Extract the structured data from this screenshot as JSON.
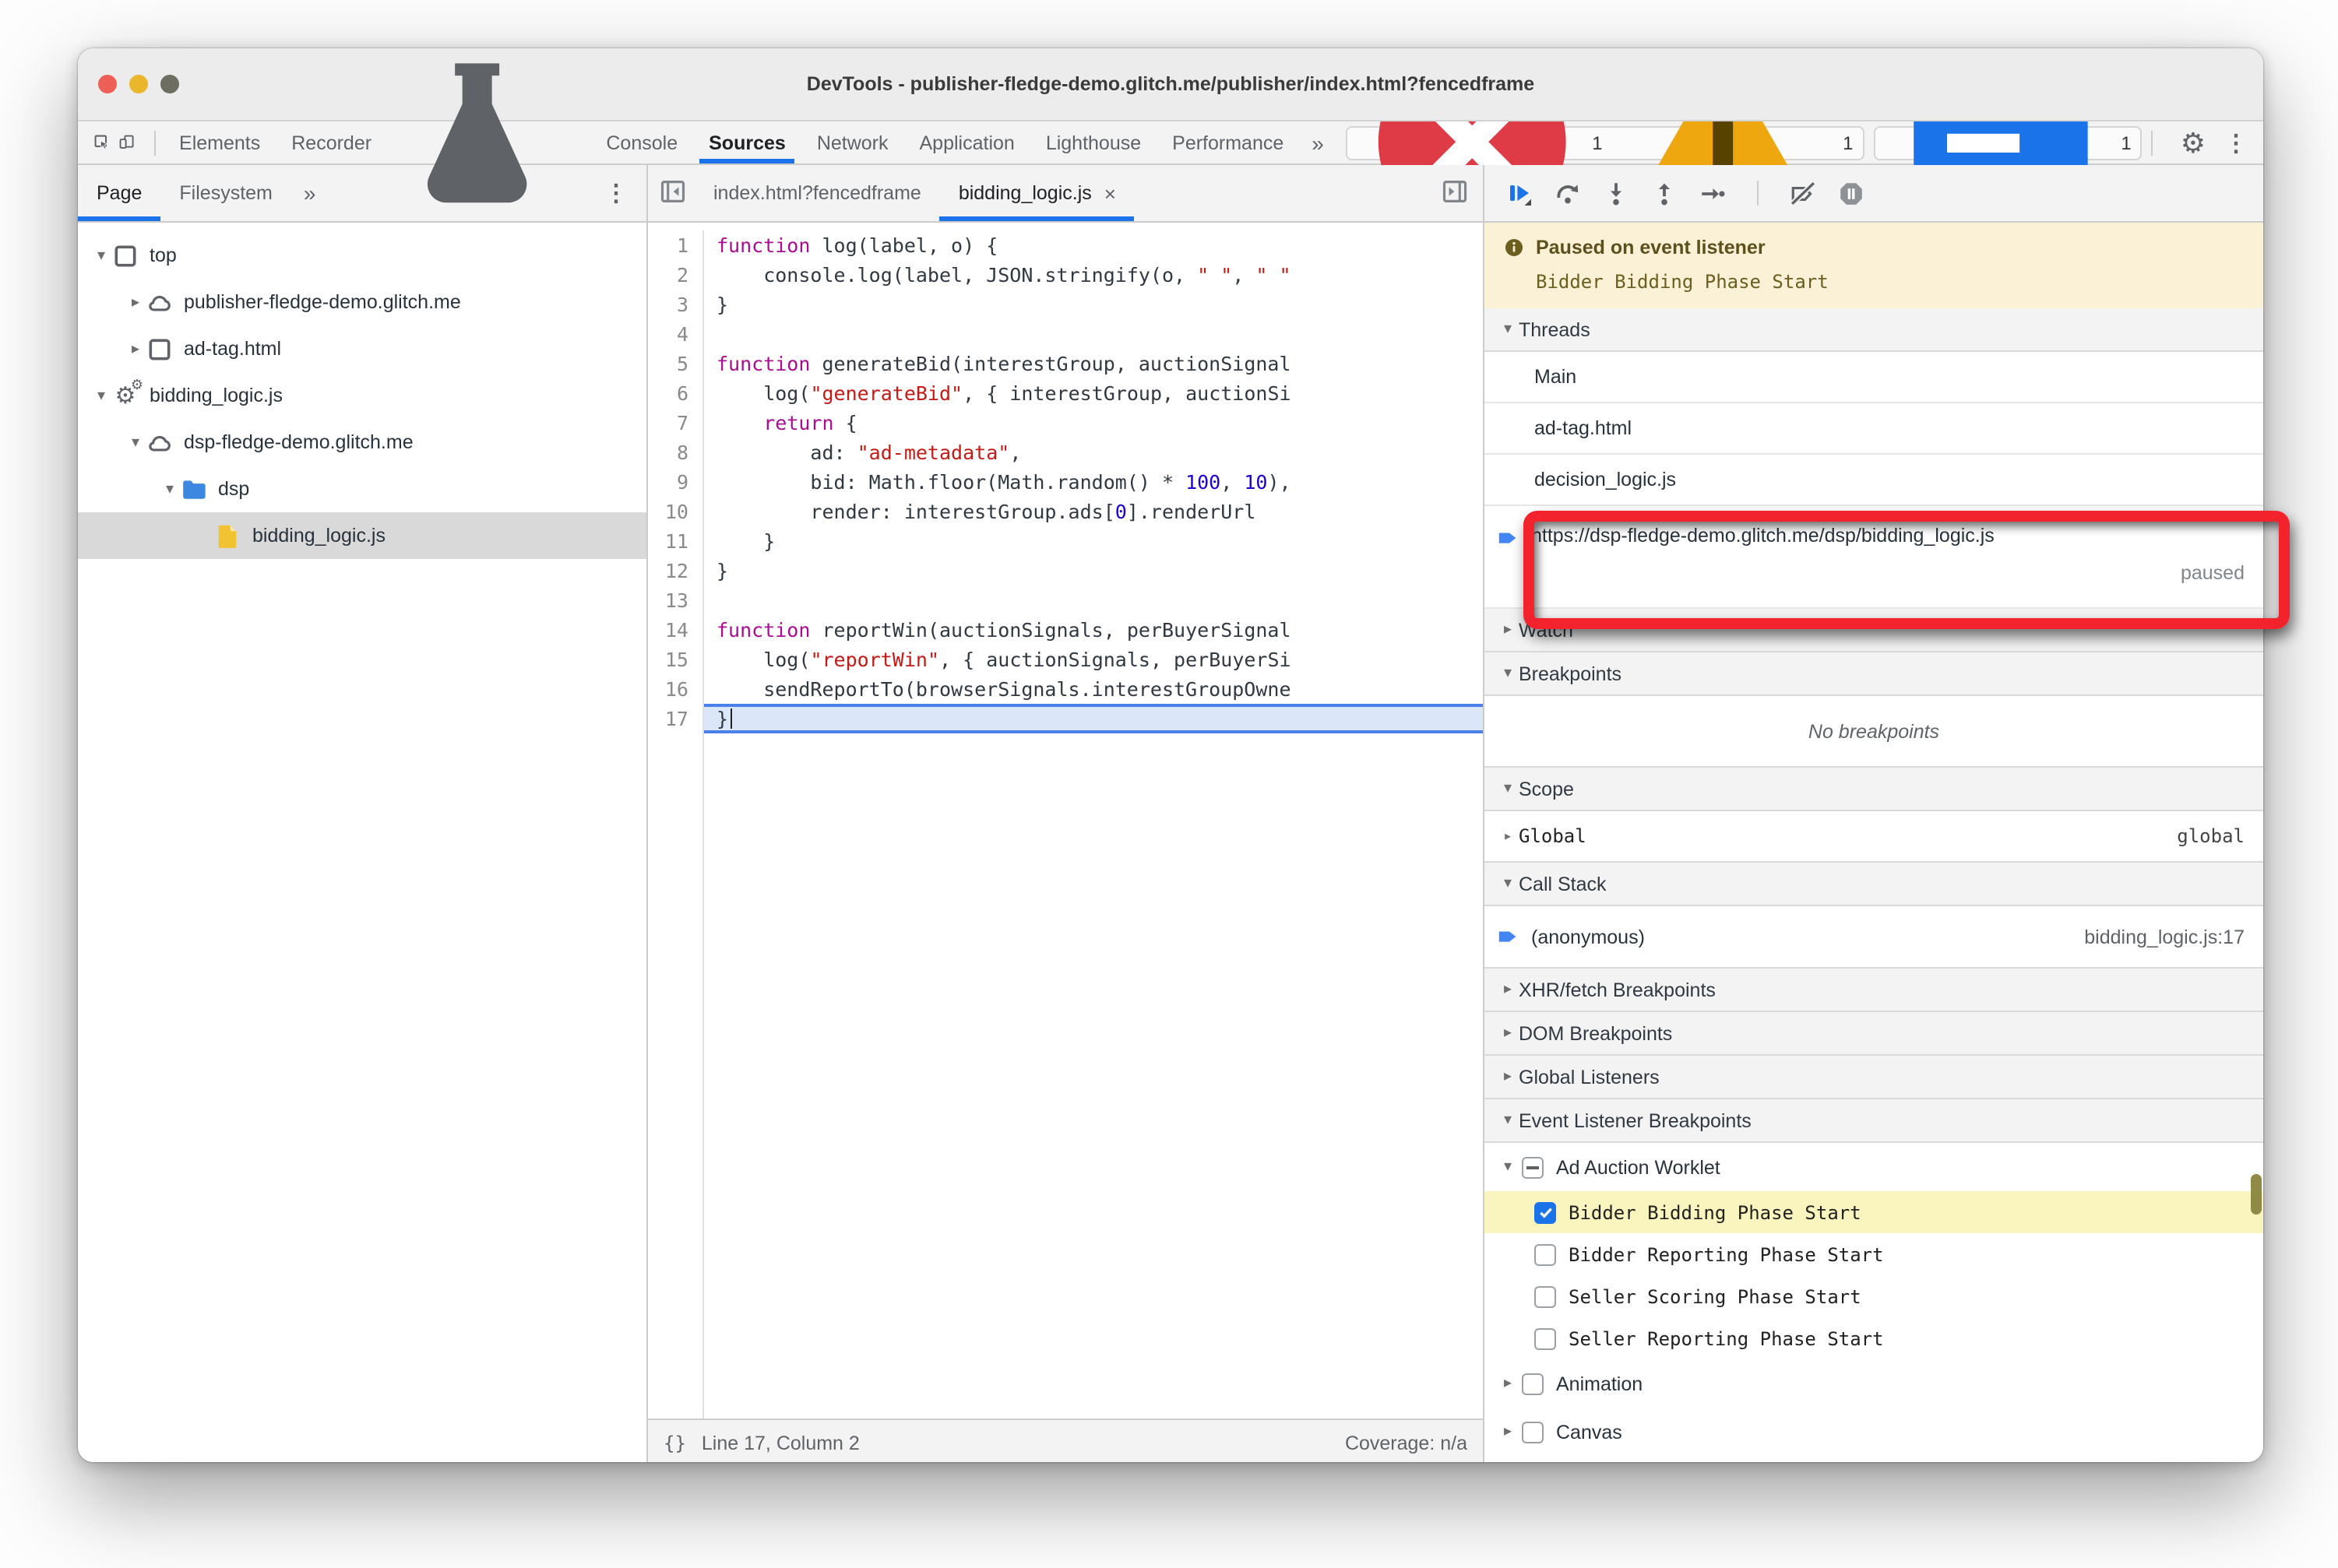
{
  "colors": {
    "accent": "#1a73e8",
    "paused_bg": "#fbf1d7",
    "highlight_yellow": "#faf5bf",
    "annotation_red": "#f2232d",
    "exec_line_blue": "#dbe6f9",
    "selected_row_gray": "#d9d9d9"
  },
  "window": {
    "title": "DevTools - publisher-fledge-demo.glitch.me/publisher/index.html?fencedframe"
  },
  "toolbar": {
    "icons": [
      "inspect-icon",
      "device-toolbar-icon"
    ],
    "tabs": [
      {
        "label": "Elements"
      },
      {
        "label": "Recorder",
        "icon": "flask-icon"
      },
      {
        "label": "Console"
      },
      {
        "label": "Sources",
        "selected": true
      },
      {
        "label": "Network"
      },
      {
        "label": "Application"
      },
      {
        "label": "Lighthouse"
      },
      {
        "label": "Performance"
      }
    ],
    "more": "»",
    "badges": {
      "error_count": "1",
      "warning_count": "1",
      "message_count": "1"
    },
    "right_icons": [
      "gear-icon",
      "kebab-menu-icon"
    ]
  },
  "sidebar": {
    "tabs": [
      {
        "label": "Page",
        "selected": true
      },
      {
        "label": "Filesystem"
      }
    ],
    "more": "»",
    "menu_icon": "kebab-menu-icon",
    "tree": [
      {
        "label": "top",
        "depth": 0,
        "icon": "frame-icon",
        "arrow": "open"
      },
      {
        "label": "publisher-fledge-demo.glitch.me",
        "depth": 1,
        "icon": "cloud-icon",
        "arrow": "closed"
      },
      {
        "label": "ad-tag.html",
        "depth": 1,
        "icon": "frame-icon",
        "arrow": "closed"
      },
      {
        "label": "bidding_logic.js",
        "depth": 0,
        "icon": "worklet-icon",
        "arrow": "open"
      },
      {
        "label": "dsp-fledge-demo.glitch.me",
        "depth": 1,
        "icon": "cloud-icon",
        "arrow": "open"
      },
      {
        "label": "dsp",
        "depth": 2,
        "icon": "folder-icon",
        "arrow": "open"
      },
      {
        "label": "bidding_logic.js",
        "depth": 3,
        "icon": "file-icon",
        "arrow": "none",
        "selected": true
      }
    ]
  },
  "editor": {
    "nav_left_icon": "tab-nav-left-icon",
    "nav_right_icon": "tab-nav-right-icon",
    "tabs": [
      {
        "label": "index.html?fencedframe",
        "active": false,
        "closable": false
      },
      {
        "label": "bidding_logic.js",
        "active": true,
        "closable": true,
        "close_glyph": "×"
      }
    ],
    "highlighted_line": 17,
    "code_lines": [
      {
        "n": "1",
        "tokens": [
          [
            "k",
            "function"
          ],
          [
            "d",
            " log(label, o) {"
          ]
        ]
      },
      {
        "n": "2",
        "tokens": [
          [
            "d",
            "    console.log(label, JSON.stringify(o, "
          ],
          [
            "s",
            "\" \""
          ],
          [
            "d",
            ", "
          ],
          [
            "s",
            "\" \""
          ]
        ]
      },
      {
        "n": "3",
        "tokens": [
          [
            "d",
            "}"
          ]
        ]
      },
      {
        "n": "4",
        "tokens": []
      },
      {
        "n": "5",
        "tokens": [
          [
            "k",
            "function"
          ],
          [
            "d",
            " generateBid(interestGroup, auctionSignal"
          ]
        ]
      },
      {
        "n": "6",
        "tokens": [
          [
            "d",
            "    log("
          ],
          [
            "s",
            "\"generateBid\""
          ],
          [
            "d",
            ", { interestGroup, auctionSi"
          ]
        ]
      },
      {
        "n": "7",
        "tokens": [
          [
            "d",
            "    "
          ],
          [
            "k",
            "return"
          ],
          [
            "d",
            " {"
          ]
        ]
      },
      {
        "n": "8",
        "tokens": [
          [
            "d",
            "        ad: "
          ],
          [
            "s",
            "\"ad-metadata\""
          ],
          [
            "d",
            ","
          ]
        ]
      },
      {
        "n": "9",
        "tokens": [
          [
            "d",
            "        bid: Math.floor(Math.random() * "
          ],
          [
            "n2",
            "100"
          ],
          [
            "d",
            ", "
          ],
          [
            "n2",
            "10"
          ],
          [
            "d",
            "),"
          ]
        ]
      },
      {
        "n": "10",
        "tokens": [
          [
            "d",
            "        render: interestGroup.ads["
          ],
          [
            "n2",
            "0"
          ],
          [
            "d",
            "].renderUrl"
          ]
        ]
      },
      {
        "n": "11",
        "tokens": [
          [
            "d",
            "    }"
          ]
        ]
      },
      {
        "n": "12",
        "tokens": [
          [
            "d",
            "}"
          ]
        ]
      },
      {
        "n": "13",
        "tokens": []
      },
      {
        "n": "14",
        "tokens": [
          [
            "k",
            "function"
          ],
          [
            "d",
            " reportWin(auctionSignals, perBuyerSignal"
          ]
        ]
      },
      {
        "n": "15",
        "tokens": [
          [
            "d",
            "    log("
          ],
          [
            "s",
            "\"reportWin\""
          ],
          [
            "d",
            ", { auctionSignals, perBuyerSi"
          ]
        ]
      },
      {
        "n": "16",
        "tokens": [
          [
            "d",
            "    sendReportTo(browserSignals.interestGroupOwne"
          ]
        ]
      },
      {
        "n": "17",
        "tokens": [
          [
            "d",
            "}"
          ]
        ]
      }
    ],
    "status": {
      "pretty_print": "{}",
      "position": "Line 17, Column 2",
      "coverage": "Coverage: n/a"
    }
  },
  "debugger": {
    "toolbar_icons": [
      "resume-icon",
      "step-over-icon",
      "step-into-icon",
      "step-out-icon",
      "step-icon",
      "separator",
      "deactivate-breakpoints-icon",
      "pause-on-exceptions-icon"
    ],
    "paused_message": {
      "icon": "info-icon",
      "title": "Paused on event listener",
      "detail": "Bidder Bidding Phase Start"
    },
    "sections": [
      {
        "type": "hdr",
        "label": "Threads",
        "arrow": "▾"
      },
      {
        "type": "thread",
        "label": "Main"
      },
      {
        "type": "thread",
        "label": "ad-tag.html"
      },
      {
        "type": "thread",
        "label": "decision_logic.js"
      },
      {
        "type": "thread-current",
        "label": "https://dsp-fledge-demo.glitch.me/dsp/bidding_logic.js",
        "status": "paused",
        "icon": "execution-arrow-icon"
      },
      {
        "type": "hdr",
        "label": "Watch",
        "arrow": "▸"
      },
      {
        "type": "hdr",
        "label": "Breakpoints",
        "arrow": "▾"
      },
      {
        "type": "empty",
        "label": "No breakpoints"
      },
      {
        "type": "hdr",
        "label": "Scope",
        "arrow": "▾"
      },
      {
        "type": "scope",
        "label": "Global",
        "value": "global",
        "arrow": "▸"
      },
      {
        "type": "hdr",
        "label": "Call Stack",
        "arrow": "▾"
      },
      {
        "type": "frame",
        "label": "(anonymous)",
        "location": "bidding_logic.js:17",
        "icon": "execution-arrow-icon"
      },
      {
        "type": "hdr",
        "label": "XHR/fetch Breakpoints",
        "arrow": "▸"
      },
      {
        "type": "hdr",
        "label": "DOM Breakpoints",
        "arrow": "▸"
      },
      {
        "type": "hdr",
        "label": "Global Listeners",
        "arrow": "▸"
      },
      {
        "type": "hdr",
        "label": "Event Listener Breakpoints",
        "arrow": "▾"
      },
      {
        "type": "cat",
        "label": "Ad Auction Worklet",
        "arrow": "▾",
        "state": "indeterminate"
      },
      {
        "type": "cb",
        "label": "Bidder Bidding Phase Start",
        "checked": true,
        "highlight": true
      },
      {
        "type": "cb",
        "label": "Bidder Reporting Phase Start",
        "checked": false
      },
      {
        "type": "cb",
        "label": "Seller Scoring Phase Start",
        "checked": false
      },
      {
        "type": "cb",
        "label": "Seller Reporting Phase Start",
        "checked": false
      },
      {
        "type": "cat",
        "label": "Animation",
        "arrow": "▸",
        "state": "off"
      },
      {
        "type": "cat",
        "label": "Canvas",
        "arrow": "▸",
        "state": "off"
      }
    ]
  }
}
